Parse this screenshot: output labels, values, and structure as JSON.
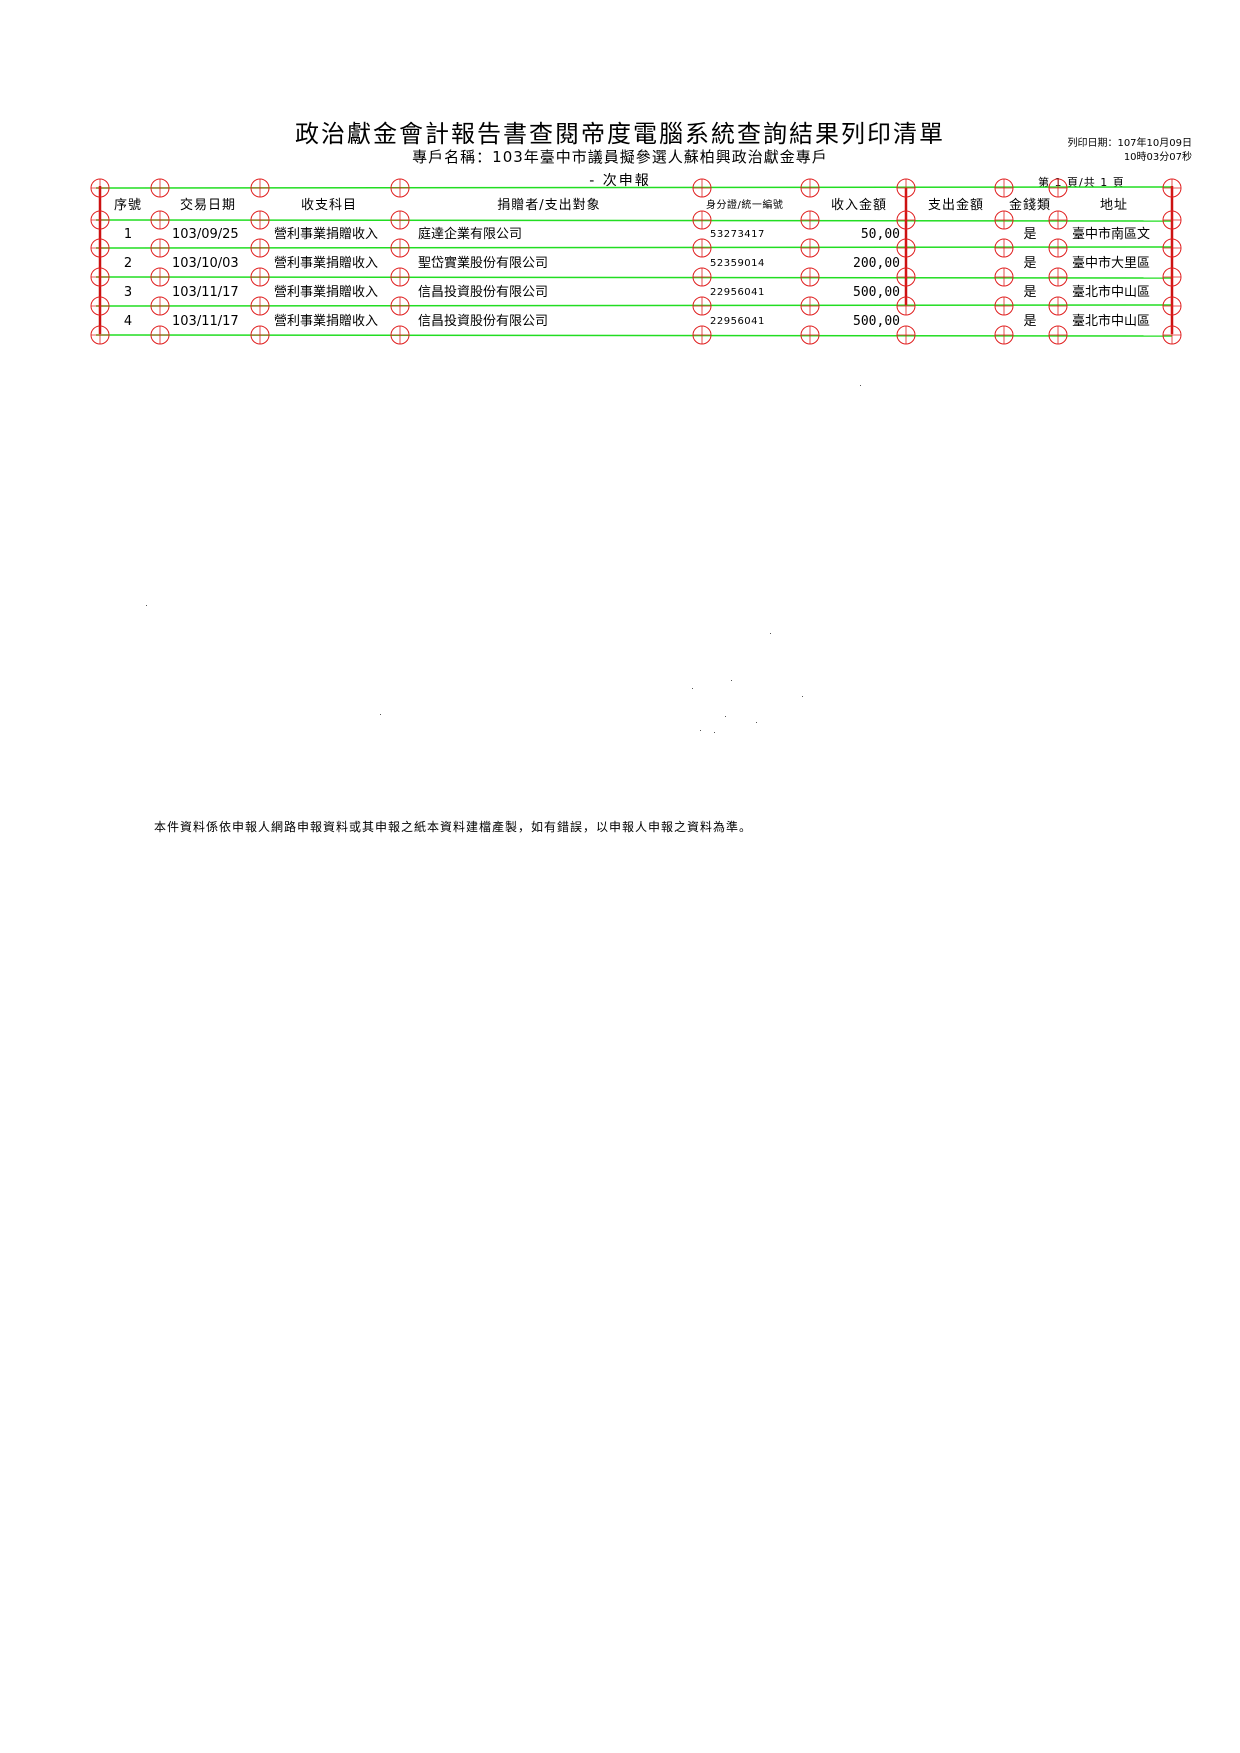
{
  "document": {
    "title": "政治獻金會計報告書查閱帝度電腦系統查詢結果列印清單",
    "subtitle": "專戶名稱：103年臺中市議員擬參選人蘇柏興政治獻金專戶",
    "report_line": "- 次申報",
    "print_date_line1": "列印日期：107年10月09日",
    "print_date_line2": "10時03分07秒",
    "page_indicator": "第 1 頁/共 1 頁",
    "footer_note": "本件資料係依申報人網路申報資料或其申報之紙本資料建檔產製，如有錯誤，以申報人申報之資料為準。"
  },
  "table": {
    "headers": [
      "序號",
      "交易日期",
      "收支科目",
      "捐贈者/支出對象",
      "身分證/統一編號",
      "收入金額",
      "支出金額",
      "金錢類",
      "地址"
    ],
    "rows": [
      {
        "seq": "1",
        "date": "103/09/25",
        "category": "營利事業捐贈收入",
        "party": "庭達企業有限公司",
        "id": "53273417",
        "income": "50,00",
        "expense": "",
        "cash": "是",
        "address": "臺中市南區文"
      },
      {
        "seq": "2",
        "date": "103/10/03",
        "category": "營利事業捐贈收入",
        "party": "聖岱實業股份有限公司",
        "id": "52359014",
        "income": "200,00",
        "expense": "",
        "cash": "是",
        "address": "臺中市大里區"
      },
      {
        "seq": "3",
        "date": "103/11/17",
        "category": "營利事業捐贈收入",
        "party": "信昌投資股份有限公司",
        "id": "22956041",
        "income": "500,00",
        "expense": "",
        "cash": "是",
        "address": "臺北市中山區"
      },
      {
        "seq": "4",
        "date": "103/11/17",
        "category": "營利事業捐贈收入",
        "party": "信昌投資股份有限公司",
        "id": "22956041",
        "income": "500,00",
        "expense": "",
        "cash": "是",
        "address": "臺北市中山區"
      }
    ]
  },
  "overlay": {
    "line_color": "#22dd22",
    "marker_color": "#e02020",
    "separator_color": "#cc1111"
  }
}
